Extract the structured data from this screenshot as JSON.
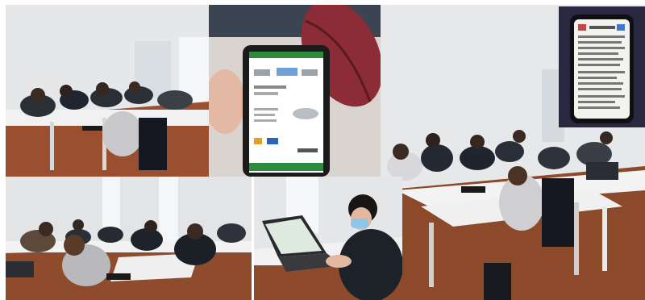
{
  "collage": {
    "tiles": [
      {
        "name": "photo-classroom-students-writing-left"
      },
      {
        "name": "photo-hand-holding-phone-car-rental-app"
      },
      {
        "name": "photo-classroom-wide-view-right"
      },
      {
        "name": "photo-phone-screen-closeup-inset"
      },
      {
        "name": "photo-classroom-students-bottom-left"
      },
      {
        "name": "photo-student-with-laptop-mask"
      }
    ]
  },
  "colors": {
    "wall": "#e8e9ea",
    "floor": "#8a4b2c",
    "desk": "#f2f2f2",
    "phone_green": "#2e8b3e",
    "pencil_case": "#8b2c36"
  }
}
